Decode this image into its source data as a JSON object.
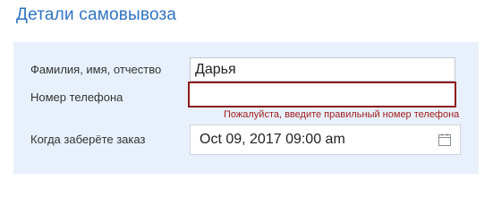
{
  "section": {
    "title": "Детали самовывоза"
  },
  "form": {
    "name": {
      "label": "Фамилия, имя, отчество",
      "value": "Дарья"
    },
    "phone": {
      "label": "Номер телефона",
      "value": "",
      "error": "Пожалуйста, введите правильный номер телефона"
    },
    "pickup": {
      "label": "Когда заберёте заказ",
      "value": "Oct 09, 2017 09:00 am",
      "icon": "calendar-icon"
    }
  },
  "colors": {
    "title": "#2f73c1",
    "panel_bg": "#e8f1fb",
    "error": "#a12020",
    "error_border": "#8b1a1a"
  }
}
